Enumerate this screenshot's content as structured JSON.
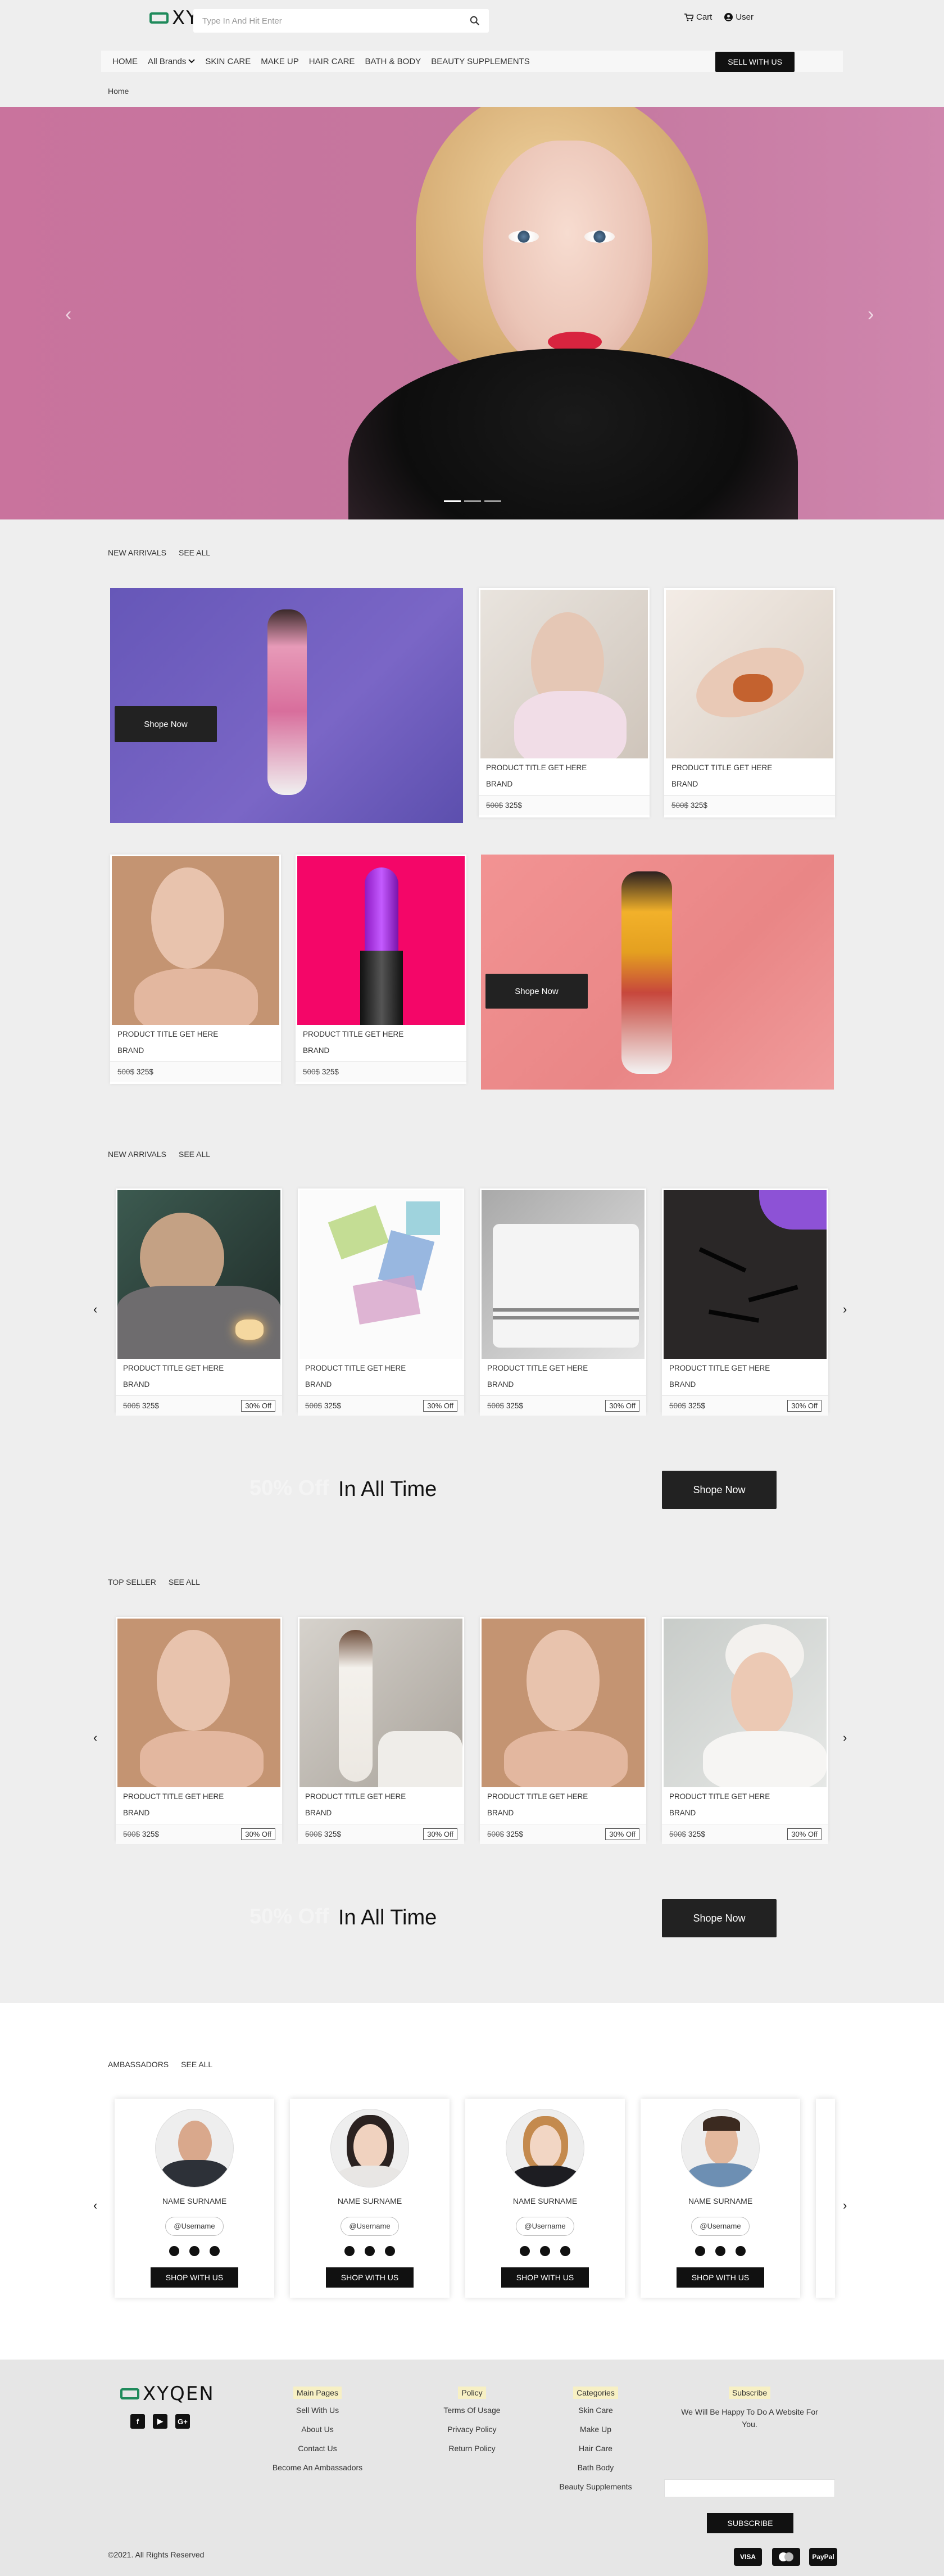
{
  "header": {
    "logo_text": "XYQEN",
    "search_placeholder": "Type In And Hit Enter",
    "cart_label": "Cart",
    "user_label": "User"
  },
  "nav": {
    "items": [
      "HOME",
      "All Brands",
      "SKIN CARE",
      "MAKE UP",
      "HAIR CARE",
      "BATH & BODY",
      "BEAUTY SUPPLEMENTS"
    ],
    "sell_label": "SELL WITH US"
  },
  "breadcrumb": "Home",
  "section1": {
    "title": "NEW ARRIVALS",
    "see_all": "SEE ALL",
    "promo_button": "Shope Now"
  },
  "product": {
    "title": "PRODUCT TITLE GET HERE",
    "brand": "BRAND",
    "old_price": "500$",
    "new_price": "325$",
    "discount": "30% Off"
  },
  "section2": {
    "title": "NEW ARRIVALS",
    "see_all": "SEE ALL"
  },
  "section3": {
    "title": "TOP SELLER",
    "see_all": "SEE ALL"
  },
  "band": {
    "faint": "50% Off",
    "strong": "In All Time",
    "button": "Shope Now"
  },
  "ambassadors": {
    "title": "AMBASSADORS",
    "see_all": "SEE ALL",
    "name": "NAME SURNAME",
    "username": "@Username",
    "button": "SHOP WITH US"
  },
  "footer": {
    "logo_text": "XYQEN",
    "main_pages": {
      "heading": "Main Pages",
      "links": [
        "Sell With Us",
        "About Us",
        "Contact Us",
        "Become An Ambassadors"
      ]
    },
    "policy": {
      "heading": "Policy",
      "links": [
        "Terms Of Usage",
        "Privacy Policy",
        "Return Policy"
      ]
    },
    "categories": {
      "heading": "Categories",
      "links": [
        "Skin Care",
        "Make Up",
        "Hair Care",
        "Bath Body",
        "Beauty Supplements"
      ]
    },
    "subscribe": {
      "heading": "Subscribe",
      "text": "We Will Be Happy To Do A Website For You.",
      "button": "SUBSCRIBE"
    },
    "copyright": "©2021. All Rights Reserved",
    "payments": [
      "VISA",
      "MC",
      "PayPal"
    ]
  },
  "colors": {
    "accent": "#1f8a5b",
    "dark": "#222222",
    "hero": "#c9739d"
  }
}
